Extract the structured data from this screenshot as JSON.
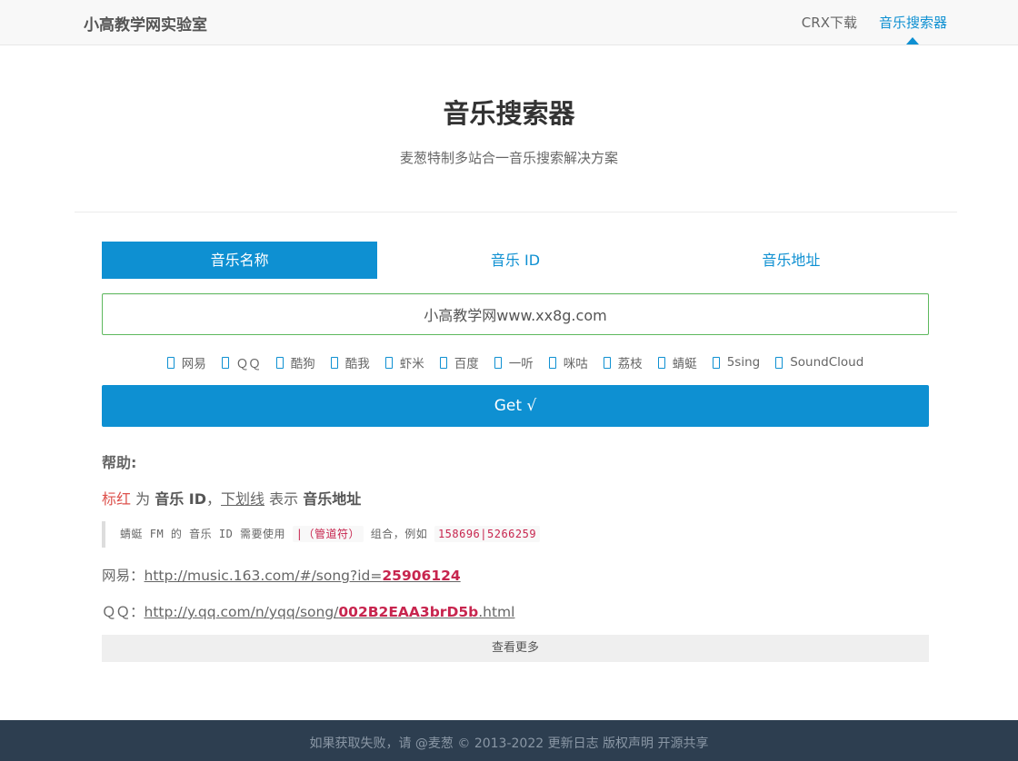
{
  "nav": {
    "brand": "小高教学网实验室",
    "links": [
      {
        "label": "CRX下载"
      },
      {
        "label": "音乐搜索器"
      }
    ]
  },
  "header": {
    "title": "音乐搜索器",
    "subtitle": "麦葱特制多站合一音乐搜索解决方案"
  },
  "tabs": [
    {
      "label": "音乐名称"
    },
    {
      "label": "音乐 ID"
    },
    {
      "label": "音乐地址"
    }
  ],
  "search": {
    "value": "小高教学网www.xx8g.com"
  },
  "sites": [
    "网易",
    "ＱＱ",
    "酷狗",
    "酷我",
    "虾米",
    "百度",
    "一听",
    "咪咕",
    "荔枝",
    "蜻蜓",
    "5sing",
    "SoundCloud"
  ],
  "get_button": "Get √",
  "help": {
    "heading": "帮助:",
    "legend": {
      "red": "标红",
      "as1": " 为 ",
      "music_id": "音乐 ID",
      "sep": "，",
      "underline": "下划线",
      "as2": " 表示 ",
      "music_url": "音乐地址"
    },
    "note": {
      "prefix": "蜻蜓 FM 的 音乐 ID 需要使用 ",
      "pipe": "|（管道符）",
      "middle": " 组合，例如 ",
      "example": "158696|5266259"
    },
    "examples": [
      {
        "label": "网易：",
        "url_pre": "http://music.163.com/#/song?id=",
        "url_hl": "25906124",
        "url_post": ""
      },
      {
        "label": "ＱＱ：",
        "url_pre": "http://y.qq.com/n/yqq/song/",
        "url_hl": "002B2EAA3brD5b",
        "url_post": ".html"
      }
    ],
    "more_button": "查看更多"
  },
  "footer": {
    "text": "如果获取失败，请 @麦葱 © 2013-2022 更新日志 版权声明 开源共享"
  }
}
